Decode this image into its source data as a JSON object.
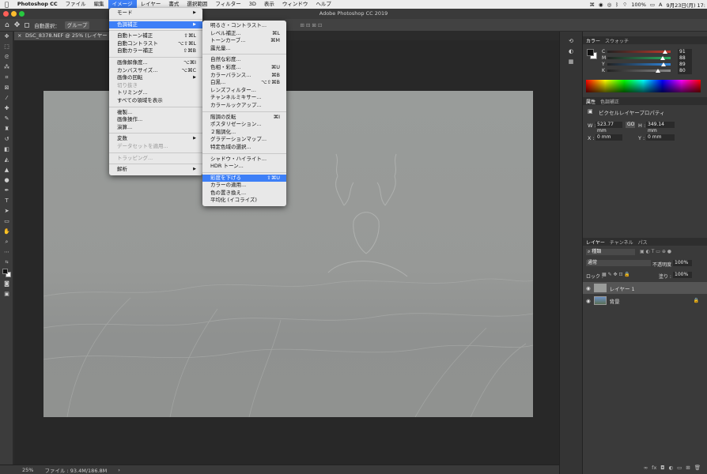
{
  "menubar": {
    "app_name": "Photoshop CC",
    "items": [
      "ファイル",
      "編集",
      "イメージ",
      "レイヤー",
      "書式",
      "選択範囲",
      "フィルター",
      "3D",
      "表示",
      "ウィンドウ",
      "ヘルプ"
    ],
    "active_item": "イメージ",
    "battery": "100%",
    "clock": "9月23日(月) 17:"
  },
  "window": {
    "title": "Adobe Photoshop CC 2019"
  },
  "options_bar": {
    "auto_select_label": "自動選択：",
    "auto_select_value": "グループ"
  },
  "document": {
    "tab_title": "DSC_8378.NEF @ 25% (レイヤー 1, R"
  },
  "status_bar": {
    "zoom": "25%",
    "file_info": "ファイル : 93.4M/186.8M"
  },
  "image_menu": [
    {
      "label": "モード",
      "shortcut": "",
      "submenu": true
    },
    {
      "sep": true
    },
    {
      "label": "色調補正",
      "shortcut": "",
      "submenu": true,
      "highlighted": true
    },
    {
      "sep": true
    },
    {
      "label": "自動トーン補正",
      "shortcut": "⇧⌘L"
    },
    {
      "label": "自動コントラスト",
      "shortcut": "⌥⇧⌘L"
    },
    {
      "label": "自動カラー補正",
      "shortcut": "⇧⌘B"
    },
    {
      "sep": true
    },
    {
      "label": "画像解像度...",
      "shortcut": "⌥⌘I"
    },
    {
      "label": "カンバスサイズ...",
      "shortcut": "⌥⌘C"
    },
    {
      "label": "画像の回転",
      "shortcut": "",
      "submenu": true
    },
    {
      "label": "切り抜き",
      "shortcut": "",
      "disabled": true
    },
    {
      "label": "トリミング...",
      "shortcut": ""
    },
    {
      "label": "すべての領域を表示",
      "shortcut": ""
    },
    {
      "sep": true
    },
    {
      "label": "複製...",
      "shortcut": ""
    },
    {
      "label": "画像操作...",
      "shortcut": ""
    },
    {
      "label": "演算...",
      "shortcut": ""
    },
    {
      "sep": true
    },
    {
      "label": "変数",
      "shortcut": "",
      "submenu": true
    },
    {
      "label": "データセットを適用...",
      "shortcut": "",
      "disabled": true
    },
    {
      "sep": true
    },
    {
      "label": "トラッピング...",
      "shortcut": "",
      "disabled": true
    },
    {
      "sep": true
    },
    {
      "label": "解析",
      "shortcut": "",
      "submenu": true
    }
  ],
  "adjust_menu": [
    {
      "label": "明るさ・コントラスト...",
      "shortcut": ""
    },
    {
      "label": "レベル補正...",
      "shortcut": "⌘L"
    },
    {
      "label": "トーンカーブ...",
      "shortcut": "⌘M"
    },
    {
      "label": "露光量...",
      "shortcut": ""
    },
    {
      "sep": true
    },
    {
      "label": "自然な彩度...",
      "shortcut": ""
    },
    {
      "label": "色相・彩度...",
      "shortcut": "⌘U"
    },
    {
      "label": "カラーバランス...",
      "shortcut": "⌘B"
    },
    {
      "label": "白黒...",
      "shortcut": "⌥⇧⌘B"
    },
    {
      "label": "レンズフィルター...",
      "shortcut": ""
    },
    {
      "label": "チャンネルミキサー...",
      "shortcut": ""
    },
    {
      "label": "カラールックアップ...",
      "shortcut": ""
    },
    {
      "sep": true
    },
    {
      "label": "階調の反転",
      "shortcut": "⌘I"
    },
    {
      "label": "ポスタリゼーション...",
      "shortcut": ""
    },
    {
      "label": "２階調化...",
      "shortcut": ""
    },
    {
      "label": "グラデーションマップ...",
      "shortcut": ""
    },
    {
      "label": "特定色域の選択...",
      "shortcut": ""
    },
    {
      "sep": true
    },
    {
      "label": "シャドウ・ハイライト...",
      "shortcut": ""
    },
    {
      "label": "HDR トーン...",
      "shortcut": ""
    },
    {
      "sep": true
    },
    {
      "label": "彩度を下げる",
      "shortcut": "⇧⌘U",
      "highlighted": true
    },
    {
      "label": "カラーの適用...",
      "shortcut": ""
    },
    {
      "label": "色の置き換え...",
      "shortcut": ""
    },
    {
      "label": "平均化 (イコライズ)",
      "shortcut": ""
    }
  ],
  "color_panel": {
    "tabs": [
      "カラー",
      "スウォッチ"
    ],
    "channels": [
      {
        "label": "C",
        "value": "91",
        "fraction": 0.91,
        "bar": "#c0392b"
      },
      {
        "label": "M",
        "value": "88",
        "fraction": 0.88,
        "bar": "#27ae60"
      },
      {
        "label": "Y",
        "value": "89",
        "fraction": 0.89,
        "bar": "#2e86de"
      },
      {
        "label": "K",
        "value": "80",
        "fraction": 0.8,
        "bar": "#888888"
      }
    ]
  },
  "properties_panel": {
    "tabs": [
      "属性",
      "色調補正"
    ],
    "title": "ピクセルレイヤープロパティ",
    "w_label": "W :",
    "w_value": "523.77 mm",
    "link_label": "GO",
    "h_label": "H :",
    "h_value": "349.14 mm",
    "x_label": "X :",
    "x_value": "0 mm",
    "y_label": "Y :",
    "y_value": "0 mm"
  },
  "layers_panel": {
    "tabs": [
      "レイヤー",
      "チャンネル",
      "パス"
    ],
    "filter_kind": "種類",
    "blend_mode": "通常",
    "opacity_label": "不透明度 :",
    "opacity_value": "100%",
    "lock_label": "ロック :",
    "fill_label": "塗り :",
    "fill_value": "100%",
    "layers": [
      {
        "name": "レイヤー 1",
        "selected": true,
        "locked": false
      },
      {
        "name": "背景",
        "selected": false,
        "locked": true
      }
    ]
  }
}
